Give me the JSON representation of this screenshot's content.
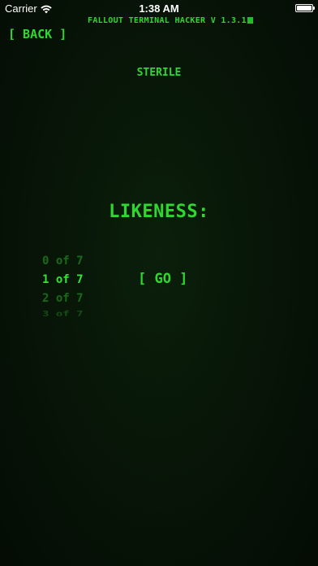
{
  "status_bar": {
    "carrier": "Carrier",
    "time": "1:38 AM",
    "wifi_icon": "wifi-icon",
    "battery_icon": "battery-icon",
    "battery_level": 1.0
  },
  "header": {
    "title": "FALLOUT TERMINAL HACKER V 1.3.1"
  },
  "nav": {
    "back_label": "[ BACK ]"
  },
  "main": {
    "word": "STERILE",
    "likeness_label": "LIKENESS:",
    "picker": {
      "options": [
        "0 of 7",
        "1 of 7",
        "2 of 7",
        "3 of 7"
      ],
      "selected": "1 of 7"
    },
    "go_label": "[ GO ]"
  },
  "colors": {
    "terminal_green": "#2fd82f",
    "background": "#071407",
    "status_text": "#ffffff"
  }
}
